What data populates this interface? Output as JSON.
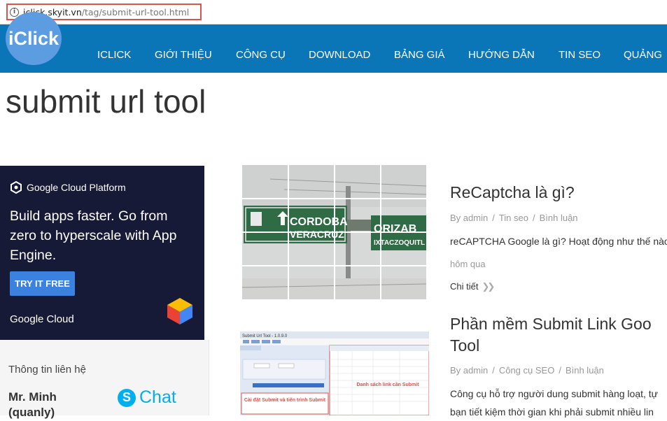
{
  "browser": {
    "host": "iclick.skyit.vn",
    "path": "/tag/submit-url-tool.html"
  },
  "header": {
    "logo": "iClick",
    "nav": [
      "ICLICK",
      "GIỚI THIỆU",
      "CÔNG CỤ",
      "DOWNLOAD",
      "BẢNG GIÁ",
      "HƯỚNG DẪN",
      "TIN SEO",
      "QUẢNG"
    ]
  },
  "page": {
    "title": "submit url tool"
  },
  "ad": {
    "brand": "Google Cloud Platform",
    "headline": "Build apps faster. Go from zero to hyperscale with App Engine.",
    "cta": "TRY IT FREE",
    "footer": "Google Cloud"
  },
  "contact": {
    "title": "Thông tin liên hệ",
    "name": "Mr. Minh",
    "sub": "(quanly)",
    "chat": "Chat"
  },
  "posts": [
    {
      "title": "ReCaptcha là gì?",
      "author": "By admin",
      "category": "Tin seo",
      "comments": "Bình luận",
      "excerpt": "reCAPTCHA Google là gì? Hoạt động như thế nào",
      "date": "hôm qua",
      "more": "Chi tiết",
      "thumb": {
        "sign_left_1": "CORDOBA",
        "sign_left_2": "VERACRUZ",
        "sign_right_1": "ORIZAB",
        "sign_right_2": "IXTACZOQUITL"
      }
    },
    {
      "title_line1": "Phần mềm Submit Link Goo",
      "title_line2": "Tool",
      "author": "By admin",
      "category": "Công cụ SEO",
      "comments": "Bình luận",
      "excerpt_line1": "Công cụ hỗ trợ người dung submit hàng loạt, tự",
      "excerpt_line2": "bạn tiết kiệm thời gian khi phải submit nhiều lin",
      "thumb": {
        "window_title": "Submit Url Tool - 1.0.9.0",
        "label_left": "Cài đặt Submit và tiến trình Submit",
        "label_right": "Danh sách link cần Submit"
      }
    }
  ],
  "colors": {
    "header_bg": "#0a76b8",
    "logo_bg": "#5b9de0",
    "ad_bg": "#161a36",
    "cta_bg": "#3b82e0",
    "skype": "#00aff0",
    "highlight": "#d9534f"
  }
}
